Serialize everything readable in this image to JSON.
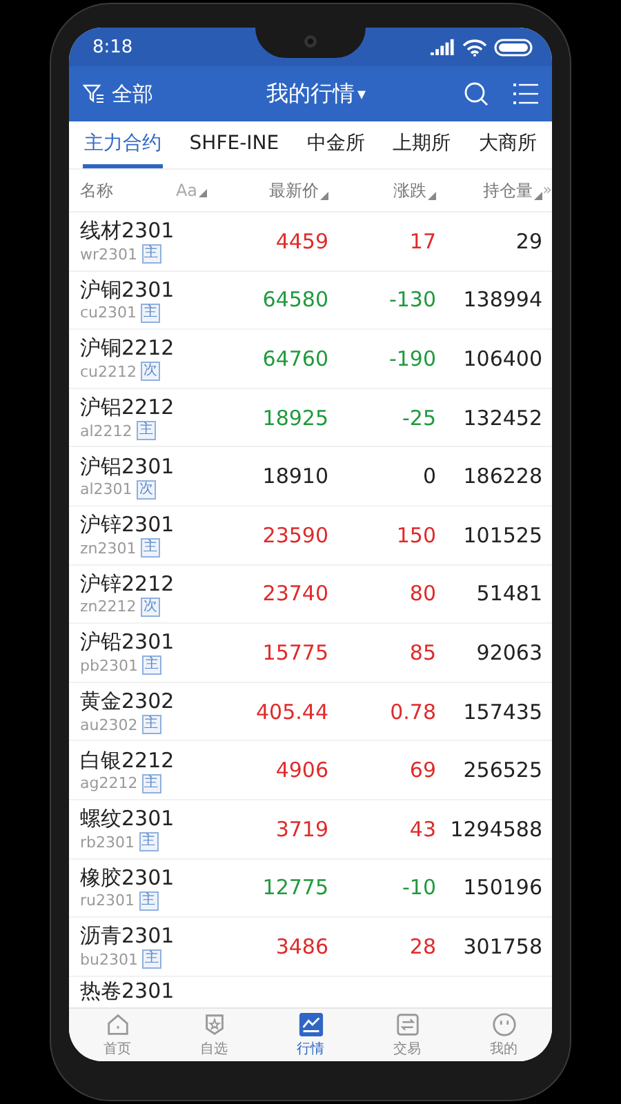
{
  "status_bar": {
    "time": "8:18"
  },
  "header": {
    "filter_label": "全部",
    "title": "我的行情",
    "title_caret": "▾"
  },
  "tabs": [
    {
      "label": "主力合约",
      "selected": true
    },
    {
      "label": "SHFE-INE",
      "selected": false
    },
    {
      "label": "中金所",
      "selected": false
    },
    {
      "label": "上期所",
      "selected": false
    },
    {
      "label": "大商所",
      "selected": false
    }
  ],
  "columns": [
    {
      "label": "名称",
      "sortable": false
    },
    {
      "label": "Aa",
      "sortable": true
    },
    {
      "label": "最新价",
      "sortable": true
    },
    {
      "label": "涨跌",
      "sortable": true
    },
    {
      "label": "持仓量",
      "sortable": true
    }
  ],
  "more_columns": "»",
  "rows": [
    {
      "name": "线材2301",
      "code": "wr2301",
      "tag": "主",
      "color": "#e02a2a",
      "price": "4459",
      "change": "17",
      "open_interest": "29"
    },
    {
      "name": "沪铜2301",
      "code": "cu2301",
      "tag": "主",
      "color": "#1f9a3d",
      "price": "64580",
      "change": "-130",
      "open_interest": "138994"
    },
    {
      "name": "沪铜2212",
      "code": "cu2212",
      "tag": "次",
      "color": "#1f9a3d",
      "price": "64760",
      "change": "-190",
      "open_interest": "106400"
    },
    {
      "name": "沪铝2212",
      "code": "al2212",
      "tag": "主",
      "color": "#1f9a3d",
      "price": "18925",
      "change": "-25",
      "open_interest": "132452"
    },
    {
      "name": "沪铝2301",
      "code": "al2301",
      "tag": "次",
      "color": "#222222",
      "price": "18910",
      "change": "0",
      "open_interest": "186228"
    },
    {
      "name": "沪锌2301",
      "code": "zn2301",
      "tag": "主",
      "color": "#e02a2a",
      "price": "23590",
      "change": "150",
      "open_interest": "101525"
    },
    {
      "name": "沪锌2212",
      "code": "zn2212",
      "tag": "次",
      "color": "#e02a2a",
      "price": "23740",
      "change": "80",
      "open_interest": "51481"
    },
    {
      "name": "沪铅2301",
      "code": "pb2301",
      "tag": "主",
      "color": "#e02a2a",
      "price": "15775",
      "change": "85",
      "open_interest": "92063"
    },
    {
      "name": "黄金2302",
      "code": "au2302",
      "tag": "主",
      "color": "#e02a2a",
      "price": "405.44",
      "change": "0.78",
      "open_interest": "157435"
    },
    {
      "name": "白银2212",
      "code": "ag2212",
      "tag": "主",
      "color": "#e02a2a",
      "price": "4906",
      "change": "69",
      "open_interest": "256525"
    },
    {
      "name": "螺纹2301",
      "code": "rb2301",
      "tag": "主",
      "color": "#e02a2a",
      "price": "3719",
      "change": "43",
      "open_interest": "1294588"
    },
    {
      "name": "橡胶2301",
      "code": "ru2301",
      "tag": "主",
      "color": "#1f9a3d",
      "price": "12775",
      "change": "-10",
      "open_interest": "150196"
    },
    {
      "name": "沥青2301",
      "code": "bu2301",
      "tag": "主",
      "color": "#e02a2a",
      "price": "3486",
      "change": "28",
      "open_interest": "301758"
    },
    {
      "name": "热卷2301"
    }
  ],
  "bottom_nav": [
    {
      "label": "首页",
      "kind": "home",
      "selected": false
    },
    {
      "label": "自选",
      "kind": "star",
      "selected": false
    },
    {
      "label": "行情",
      "kind": "chart",
      "selected": true
    },
    {
      "label": "交易",
      "kind": "swap",
      "selected": false
    },
    {
      "label": "我的",
      "kind": "face",
      "selected": false
    }
  ]
}
